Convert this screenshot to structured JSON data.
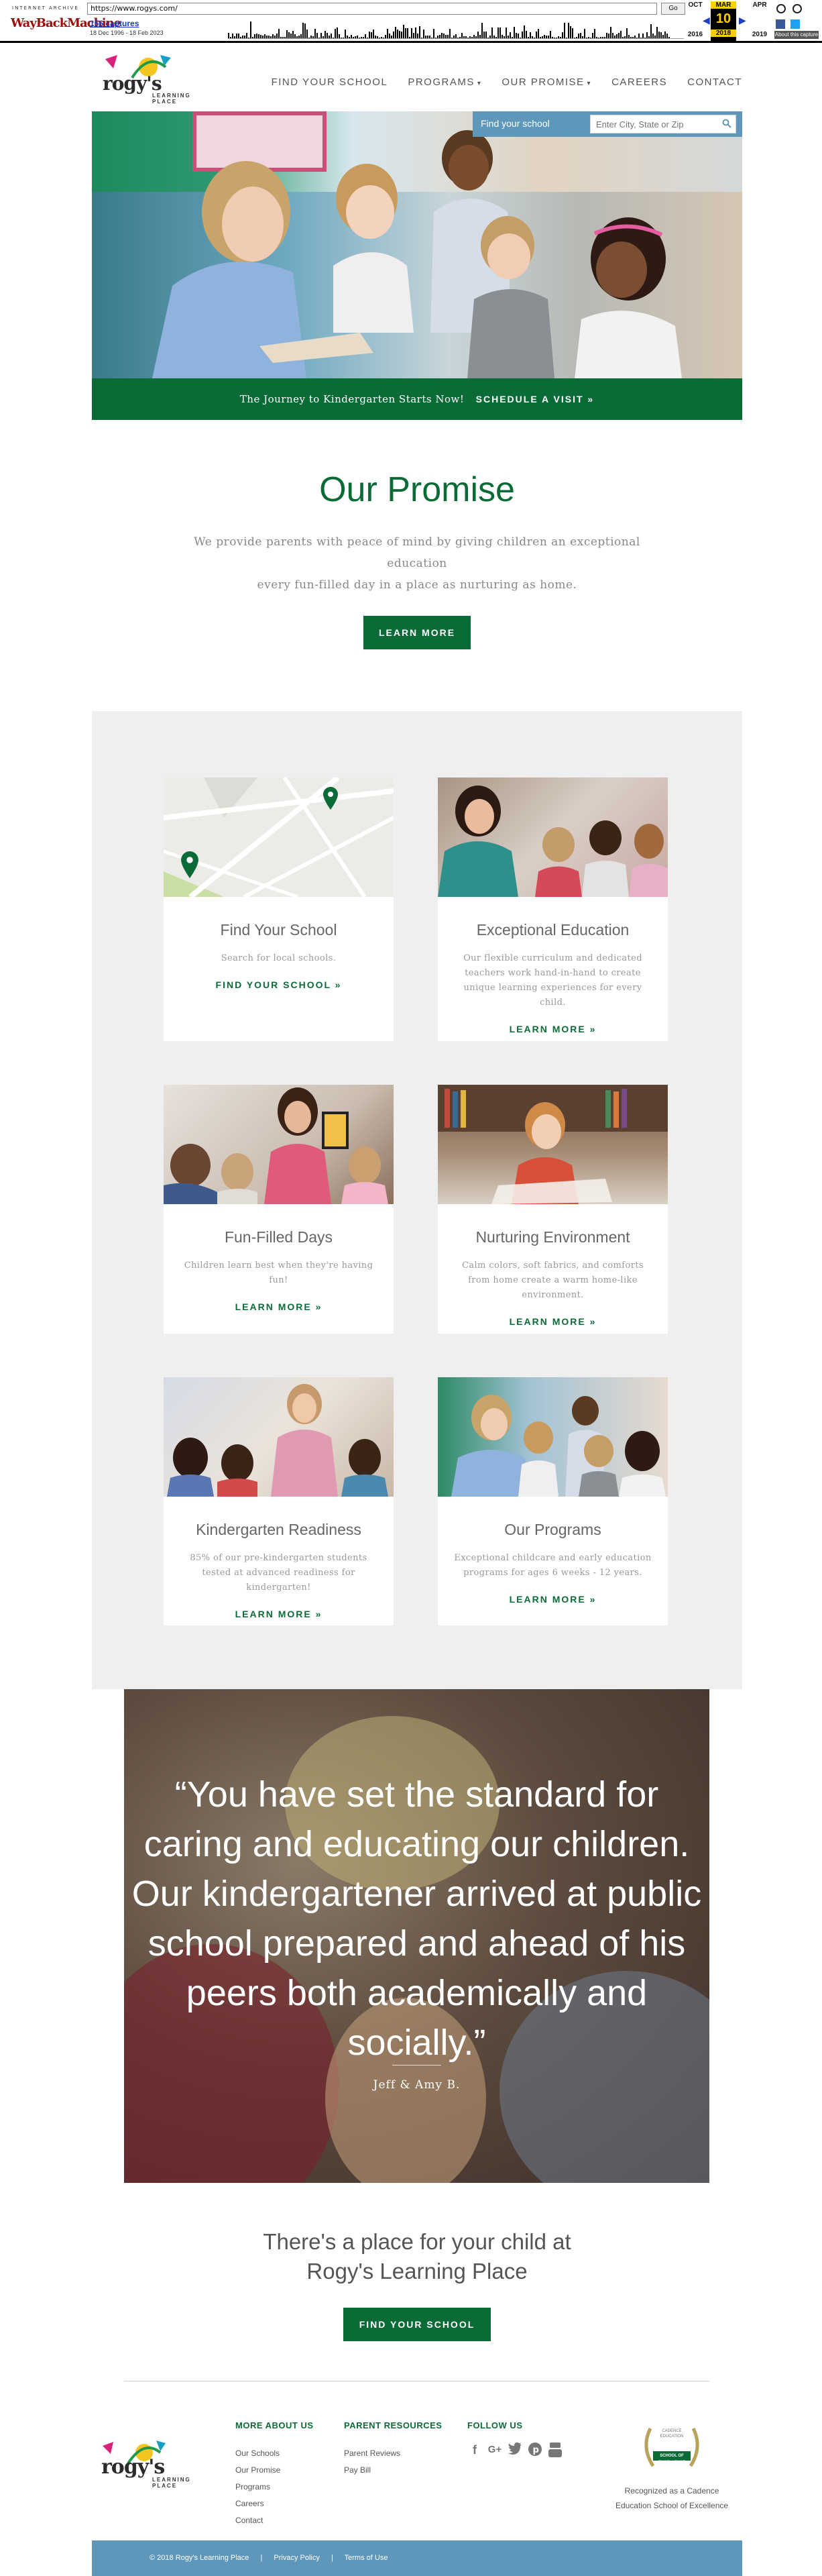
{
  "wayback": {
    "brand_top": "INTERNET ARCHIVE",
    "brand_main": "WayBackMachine",
    "url": "https://www.rogys.com/",
    "go_label": "Go",
    "captures": "156 captures",
    "range": "18 Dec 1996 - 18 Feb 2023",
    "months": {
      "prev": "OCT",
      "current": "MAR",
      "next": "APR"
    },
    "day": "10",
    "years": {
      "prev": "2016",
      "current": "2018",
      "next": "2019"
    },
    "about": "About this capture"
  },
  "header": {
    "logo_word": "rogy's",
    "logo_sub_1": "LEARNING",
    "logo_sub_2": "PLACE",
    "nav": [
      {
        "label": "FIND YOUR SCHOOL",
        "dropdown": false
      },
      {
        "label": "PROGRAMS",
        "dropdown": true
      },
      {
        "label": "OUR PROMISE",
        "dropdown": true
      },
      {
        "label": "CAREERS",
        "dropdown": false
      },
      {
        "label": "CONTACT",
        "dropdown": false
      }
    ]
  },
  "search": {
    "label": "Find your school",
    "placeholder": "Enter City, State or Zip"
  },
  "hero_band": {
    "text": "The Journey to Kindergarten Starts Now!",
    "cta": "SCHEDULE A VISIT »"
  },
  "promise": {
    "title": "Our Promise",
    "body_1": "We provide parents with peace of mind by giving children an exceptional education",
    "body_2": "every fun-filled day in a place as nurturing as home.",
    "button": "LEARN MORE"
  },
  "cards": [
    {
      "title": "Find Your School",
      "text": "Search for local schools.",
      "link": "FIND YOUR SCHOOL »",
      "image": "map-image"
    },
    {
      "title": "Exceptional Education",
      "text": "Our flexible curriculum and dedicated teachers work hand-in-hand to create unique learning experiences for every child.",
      "link": "LEARN MORE »",
      "image": "teacher-with-kids-image"
    },
    {
      "title": "Fun-Filled Days",
      "text": "Children learn best when they're having fun!",
      "link": "LEARN MORE »",
      "image": "classroom-tablet-image"
    },
    {
      "title": "Nurturing Environment",
      "text": "Calm colors, soft fabrics, and comforts from home create a warm home-like environment.",
      "link": "LEARN MORE »",
      "image": "child-reading-image"
    },
    {
      "title": "Kindergarten Readiness",
      "text": "85% of our pre-kindergarten students tested at advanced readiness for kindergarten!",
      "link": "LEARN MORE »",
      "image": "story-time-image"
    },
    {
      "title": "Our Programs",
      "text": "Exceptional childcare and early education programs for ages 6 weeks - 12 years.",
      "link": "LEARN MORE »",
      "image": "teacher-book-image"
    }
  ],
  "testimonial": {
    "quote": "“You have set the standard for caring and educating our children. Our kindergartener arrived at public school prepared and ahead of his peers both academically and socially.”",
    "author": "Jeff & Amy B."
  },
  "closing": {
    "line_1": "There's a place for your child at",
    "line_2": "Rogy's Learning Place",
    "button": "FIND YOUR SCHOOL"
  },
  "footer": {
    "logo_word": "rogy's",
    "logo_sub_1": "LEARNING",
    "logo_sub_2": "PLACE",
    "about": {
      "heading": "MORE ABOUT US",
      "items": [
        "Our Schools",
        "Our Promise",
        "Programs",
        "Careers",
        "Contact"
      ]
    },
    "parents": {
      "heading": "PARENT RESOURCES",
      "items": [
        "Parent Reviews",
        "Pay Bill"
      ]
    },
    "follow": {
      "heading": "FOLLOW US"
    },
    "badge": {
      "seal_top": "CADENCE",
      "seal_mid": "EDUCATION",
      "seal_main": "SCHOOL OF EXCELLENCE",
      "line_1": "Recognized as a Cadence",
      "line_2": "Education School of Excellence"
    },
    "bottom": {
      "copyright": "© 2018 Rogy's Learning Place",
      "privacy": "Privacy Policy",
      "terms": "Terms of Use"
    }
  },
  "colors": {
    "brand_green": "#0b6b37",
    "brand_blue": "#5e97ba"
  }
}
